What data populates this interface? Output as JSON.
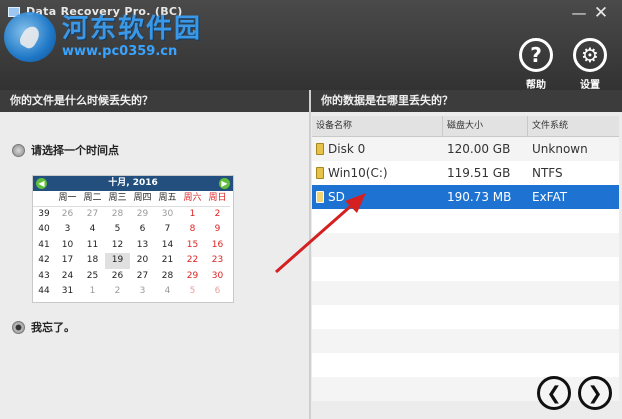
{
  "window": {
    "title": "Data Recovery Pro. (BC)",
    "minimize": "—",
    "close": "✕"
  },
  "watermark": {
    "site_name": "河东软件园",
    "url": "www.pc0359.cn"
  },
  "header": {
    "help_label": "帮助",
    "help_glyph": "?",
    "settings_label": "设置",
    "settings_glyph": "⚙"
  },
  "left": {
    "heading": "你的文件是什么时候丢失的？",
    "option_time": "请选择一个时间点",
    "option_forgot": "我忘了。",
    "selected": "forgot"
  },
  "calendar": {
    "month_label": "十月, 2016",
    "prev": "◀",
    "next": "▶",
    "weekdays": [
      "周一",
      "周二",
      "周三",
      "周四",
      "周五",
      "周六",
      "周日"
    ],
    "weeks": [
      {
        "week": "39",
        "days": [
          "26",
          "27",
          "28",
          "29",
          "30",
          "1",
          "2"
        ],
        "other": [
          true,
          true,
          true,
          true,
          true,
          false,
          false
        ]
      },
      {
        "week": "40",
        "days": [
          "3",
          "4",
          "5",
          "6",
          "7",
          "8",
          "9"
        ],
        "other": [
          false,
          false,
          false,
          false,
          false,
          false,
          false
        ]
      },
      {
        "week": "41",
        "days": [
          "10",
          "11",
          "12",
          "13",
          "14",
          "15",
          "16"
        ],
        "other": [
          false,
          false,
          false,
          false,
          false,
          false,
          false
        ]
      },
      {
        "week": "42",
        "days": [
          "17",
          "18",
          "19",
          "20",
          "21",
          "22",
          "23"
        ],
        "other": [
          false,
          false,
          false,
          false,
          false,
          false,
          false
        ]
      },
      {
        "week": "43",
        "days": [
          "24",
          "25",
          "26",
          "27",
          "28",
          "29",
          "30"
        ],
        "other": [
          false,
          false,
          false,
          false,
          false,
          false,
          false
        ]
      },
      {
        "week": "44",
        "days": [
          "31",
          "1",
          "2",
          "3",
          "4",
          "5",
          "6"
        ],
        "other": [
          false,
          true,
          true,
          true,
          true,
          true,
          true
        ]
      }
    ],
    "today": "19"
  },
  "right": {
    "heading": "你的数据是在哪里丢失的？",
    "columns": [
      "设备名称",
      "磁盘大小",
      "文件系统"
    ],
    "devices": [
      {
        "name": "Disk 0",
        "size": "120.00 GB",
        "fs": "Unknown"
      },
      {
        "name": "Win10(C:)",
        "size": "119.51 GB",
        "fs": "NTFS"
      },
      {
        "name": "SD",
        "size": "190.73 MB",
        "fs": "ExFAT"
      }
    ],
    "selected_index": 2
  },
  "nav": {
    "back_glyph": "❮",
    "next_glyph": "❯"
  },
  "colors": {
    "selection": "#1e73d2",
    "header_bg": "#3c3c3c",
    "calendar_head": "#234f7e",
    "weekend": "#dd2222",
    "annotation_arrow": "#d42020"
  }
}
